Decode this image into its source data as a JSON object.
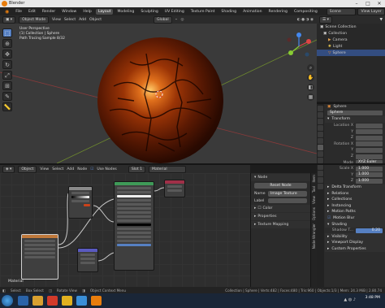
{
  "window": {
    "title": "Blender"
  },
  "menu": [
    "File",
    "Edit",
    "Render",
    "Window",
    "Help"
  ],
  "workspaces": [
    "Layout",
    "Modeling",
    "Sculpting",
    "UV Editing",
    "Texture Paint",
    "Shading",
    "Animation",
    "Rendering",
    "Compositing"
  ],
  "active_workspace": "Layout",
  "scene": {
    "label": "Scene",
    "view_layer": "View Layer"
  },
  "viewport": {
    "mode": "Object Mode",
    "menus": [
      "View",
      "Select",
      "Add",
      "Object"
    ],
    "transform": "Global",
    "overlay_lines": [
      "User Perspective",
      "(1) Collection | Sphere",
      "Path Tracing Sample 8/32"
    ]
  },
  "node_editor": {
    "editor_type": "Object",
    "menus": [
      "View",
      "Select",
      "Add",
      "Node"
    ],
    "use_nodes": "Use Nodes",
    "slot": "Slot 1",
    "material": "Material",
    "frame_label": "Material"
  },
  "node_panel": {
    "section": "Node",
    "reset_button": "Reset Node",
    "name_label": "Name",
    "name_value": "Image Texture",
    "label_label": "Label",
    "color_section": "Color",
    "properties_section": "Properties",
    "texture_mapping_section": "Texture Mapping",
    "tabs": [
      "Item",
      "Tool",
      "View",
      "Options",
      "Node Wrangler"
    ]
  },
  "outliner": {
    "root": "Scene Collection",
    "items": [
      {
        "label": "Collection",
        "color": "#d8d8d8"
      },
      {
        "label": "Camera",
        "color": "#e0a050"
      },
      {
        "label": "Light",
        "color": "#e0c050"
      },
      {
        "label": "Sphere",
        "color": "#e08a3a"
      }
    ]
  },
  "properties": {
    "object_name": "Sphere",
    "name_field": "Sphere",
    "transform": "Transform",
    "rows": [
      {
        "k": "Location X",
        "v": ""
      },
      {
        "k": "Y",
        "v": ""
      },
      {
        "k": "Z",
        "v": ""
      },
      {
        "k": "Rotation X",
        "v": ""
      },
      {
        "k": "Y",
        "v": ""
      },
      {
        "k": "Z",
        "v": ""
      },
      {
        "k": "Mode",
        "v": "XYZ Euler"
      },
      {
        "k": "Scale X",
        "v": "1.000"
      },
      {
        "k": "Y",
        "v": "1.000"
      },
      {
        "k": "Z",
        "v": "1.000"
      }
    ],
    "sections": [
      "Delta Transform",
      "Relations",
      "Collections",
      "Instancing",
      "Motion Paths",
      "Motion Blur",
      "Shading"
    ],
    "shadow_label": "Shadow T...",
    "shadow_value": "0.20",
    "sections2": [
      "Visibility",
      "Viewport Display",
      "Custom Properties"
    ]
  },
  "statusbar": [
    "Select",
    "Box Select",
    "Rotate View",
    "Object Context Menu",
    "Collection | Sphere | Verts:482 | Faces:480 | Tris:960 | Objects:1/3 | Mem: 24.3 MiB | 2.80.74"
  ],
  "clock": {
    "time": "3:48 PM",
    "date": ""
  },
  "colors": {
    "accent": "#5680c2",
    "selection": "#334d80",
    "sphere": "#c8521a"
  }
}
